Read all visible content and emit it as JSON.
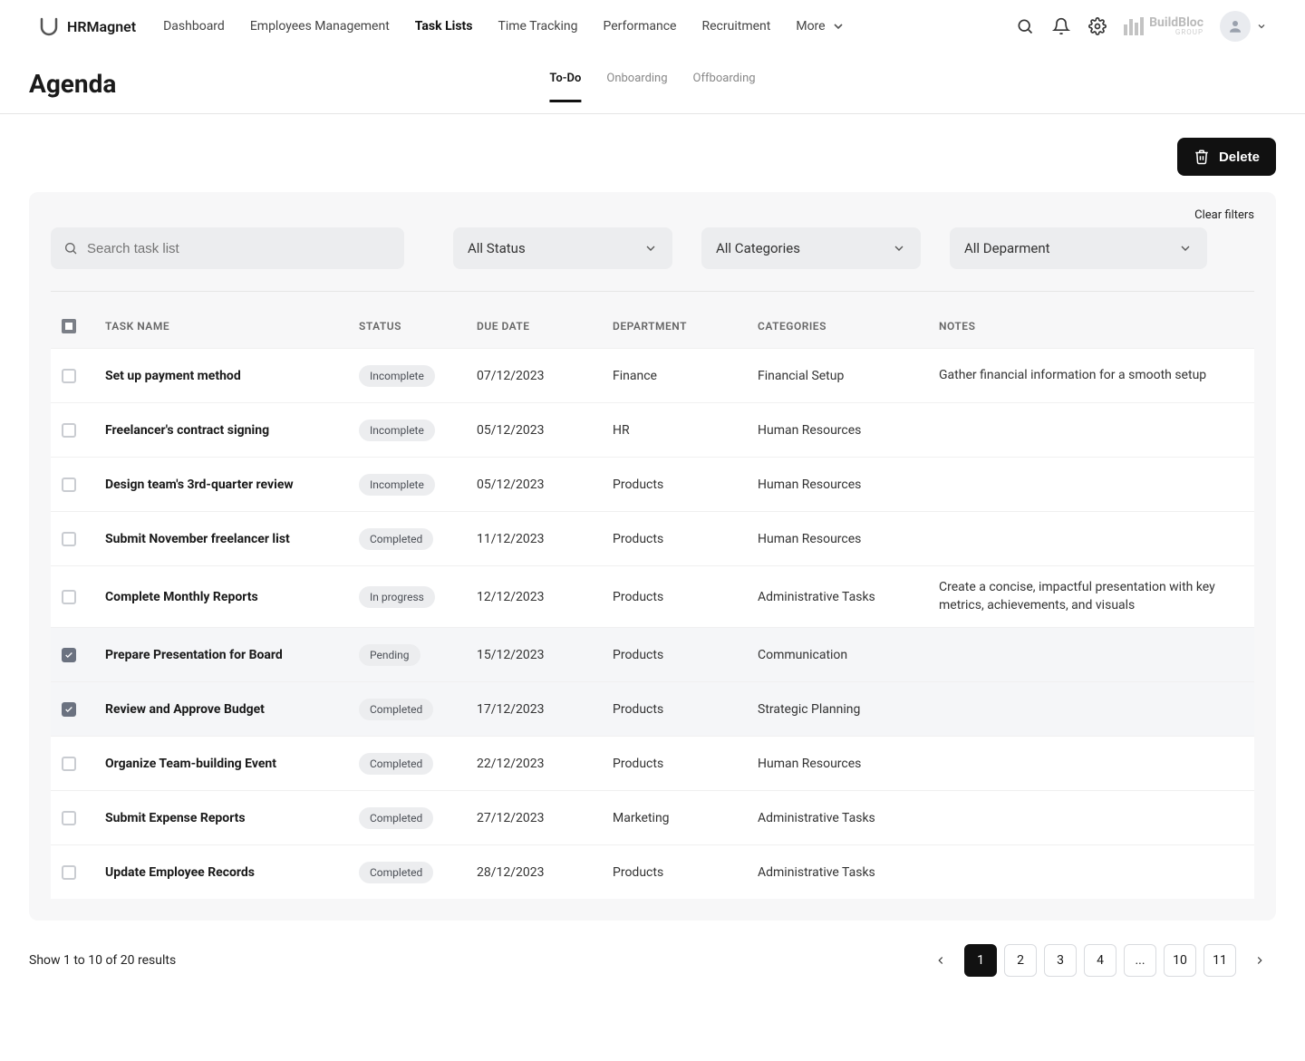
{
  "brand": {
    "name": "HRMagnet"
  },
  "nav": {
    "items": [
      {
        "label": "Dashboard",
        "active": false
      },
      {
        "label": "Employees Management",
        "active": false
      },
      {
        "label": "Task Lists",
        "active": true
      },
      {
        "label": "Time Tracking",
        "active": false
      },
      {
        "label": "Performance",
        "active": false
      },
      {
        "label": "Recruitment",
        "active": false
      }
    ],
    "more_label": "More"
  },
  "company": {
    "line1": "BuildBloc",
    "line2": "GROUP"
  },
  "page": {
    "title": "Agenda",
    "tabs": [
      {
        "label": "To-Do",
        "active": true
      },
      {
        "label": "Onboarding",
        "active": false
      },
      {
        "label": "Offboarding",
        "active": false
      }
    ]
  },
  "actions": {
    "delete_label": "Delete"
  },
  "filters": {
    "clear_label": "Clear filters",
    "search_placeholder": "Search task list",
    "status": "All Status",
    "categories": "All Categories",
    "department": "All Deparment"
  },
  "table": {
    "headers": {
      "task": "TASK NAME",
      "status": "STATUS",
      "due": "DUE DATE",
      "department": "DEPARTMENT",
      "categories": "CATEGORIES",
      "notes": "NOTES"
    },
    "rows": [
      {
        "checked": false,
        "task": "Set up payment method",
        "status": "Incomplete",
        "due": "07/12/2023",
        "department": "Finance",
        "categories": "Financial Setup",
        "notes": "Gather financial information for a smooth setup"
      },
      {
        "checked": false,
        "task": "Freelancer's contract signing",
        "status": "Incomplete",
        "due": "05/12/2023",
        "department": "HR",
        "categories": "Human Resources",
        "notes": ""
      },
      {
        "checked": false,
        "task": "Design team's 3rd-quarter review",
        "status": "Incomplete",
        "due": "05/12/2023",
        "department": "Products",
        "categories": "Human Resources",
        "notes": ""
      },
      {
        "checked": false,
        "task": "Submit November freelancer list",
        "status": "Completed",
        "due": "11/12/2023",
        "department": "Products",
        "categories": "Human Resources",
        "notes": ""
      },
      {
        "checked": false,
        "task": "Complete Monthly Reports",
        "status": "In progress",
        "due": "12/12/2023",
        "department": "Products",
        "categories": "Administrative Tasks",
        "notes": "Create a concise, impactful presentation with key metrics, achievements, and visuals"
      },
      {
        "checked": true,
        "task": "Prepare Presentation for Board",
        "status": "Pending",
        "due": "15/12/2023",
        "department": "Products",
        "categories": "Communication",
        "notes": ""
      },
      {
        "checked": true,
        "task": "Review and Approve Budget",
        "status": "Completed",
        "due": "17/12/2023",
        "department": "Products",
        "categories": "Strategic Planning",
        "notes": ""
      },
      {
        "checked": false,
        "task": "Organize Team-building Event",
        "status": "Completed",
        "due": "22/12/2023",
        "department": "Products",
        "categories": "Human Resources",
        "notes": ""
      },
      {
        "checked": false,
        "task": "Submit Expense Reports",
        "status": "Completed",
        "due": "27/12/2023",
        "department": "Marketing",
        "categories": "Administrative Tasks",
        "notes": ""
      },
      {
        "checked": false,
        "task": "Update Employee Records",
        "status": "Completed",
        "due": "28/12/2023",
        "department": "Products",
        "categories": "Administrative Tasks",
        "notes": ""
      }
    ]
  },
  "pagination": {
    "results_text": "Show 1 to 10 of 20 results",
    "pages": [
      {
        "label": "1",
        "active": true,
        "ellipsis": false
      },
      {
        "label": "2",
        "active": false,
        "ellipsis": false
      },
      {
        "label": "3",
        "active": false,
        "ellipsis": false
      },
      {
        "label": "4",
        "active": false,
        "ellipsis": false
      },
      {
        "label": "...",
        "active": false,
        "ellipsis": true
      },
      {
        "label": "10",
        "active": false,
        "ellipsis": false
      },
      {
        "label": "11",
        "active": false,
        "ellipsis": false
      }
    ]
  }
}
